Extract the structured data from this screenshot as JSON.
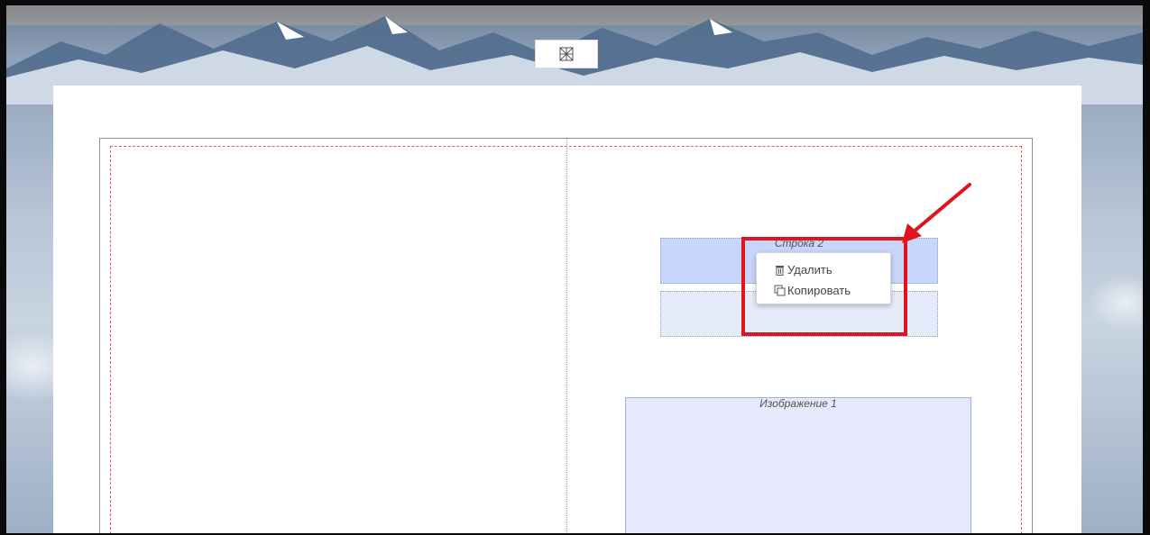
{
  "context_menu": {
    "items": [
      {
        "label": "Удалить",
        "icon": "trash-icon"
      },
      {
        "label": "Копировать",
        "icon": "copy-icon"
      }
    ]
  },
  "canvas": {
    "row_label": "Строка 2",
    "image_label": "Изображение 1"
  },
  "colors": {
    "highlight": "#e0141c",
    "margin_guide": "#e05b5b",
    "selected_row": "#c9d6fb",
    "placeholder_fill": "#e5e9fb"
  }
}
